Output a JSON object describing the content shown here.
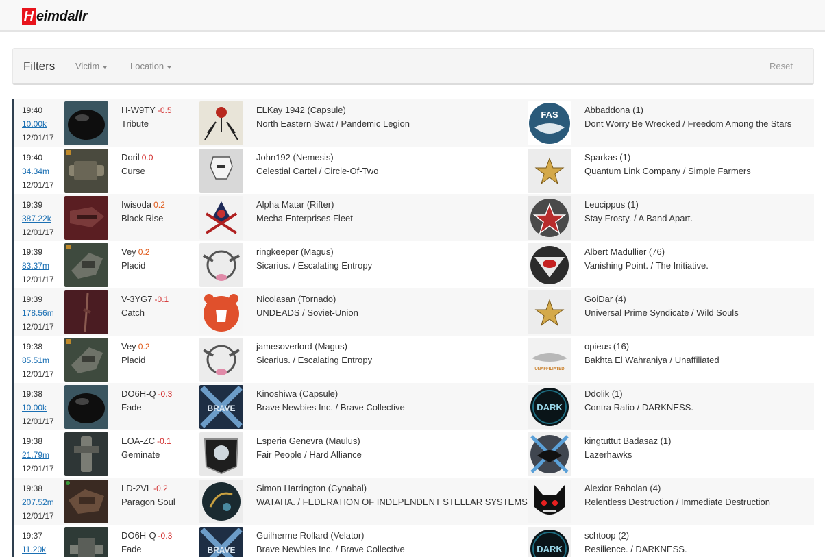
{
  "brand": {
    "first_letter": "H",
    "rest": "eimdallr"
  },
  "filters": {
    "title": "Filters",
    "victim_label": "Victim",
    "location_label": "Location",
    "reset_label": "Reset"
  },
  "kills": [
    {
      "time": "19:40",
      "value": "10.00k",
      "date": "12/01/17",
      "system": "H-W9TY",
      "security": "-0.5",
      "ship": "Tribute",
      "victim": "ELKay 1942 (Capsule)",
      "victim_org": "North Eastern Swat / Pandemic Legion",
      "killer": "Abbaddona (1)",
      "killer_org": "Dont Worry Be Wrecked / Freedom Among the Stars"
    },
    {
      "time": "19:40",
      "value": "34.34m",
      "date": "12/01/17",
      "system": "Doril",
      "security": "0.0",
      "ship": "Curse",
      "victim": "John192 (Nemesis)",
      "victim_org": "Celestial Cartel / Circle-Of-Two",
      "killer": "Sparkas (1)",
      "killer_org": "Quantum Link Company / Simple Farmers"
    },
    {
      "time": "19:39",
      "value": "387.22k",
      "date": "12/01/17",
      "system": "Iwisoda",
      "security": "0.2",
      "ship": "Black Rise",
      "victim": "Alpha Matar (Rifter)",
      "victim_org": "Mecha Enterprises Fleet",
      "killer": "Leucippus (1)",
      "killer_org": "Stay Frosty. / A Band Apart."
    },
    {
      "time": "19:39",
      "value": "83.37m",
      "date": "12/01/17",
      "system": "Vey",
      "security": "0.2",
      "ship": "Placid",
      "victim": "ringkeeper (Magus)",
      "victim_org": "Sicarius. / Escalating Entropy",
      "killer": "Albert Madullier (76)",
      "killer_org": "Vanishing Point. / The Initiative."
    },
    {
      "time": "19:39",
      "value": "178.56m",
      "date": "12/01/17",
      "system": "V-3YG7",
      "security": "-0.1",
      "ship": "Catch",
      "victim": "Nicolasan (Tornado)",
      "victim_org": "UNDEADS / Soviet-Union",
      "killer": "GoiDar (4)",
      "killer_org": "Universal Prime Syndicate / Wild Souls"
    },
    {
      "time": "19:38",
      "value": "85.51m",
      "date": "12/01/17",
      "system": "Vey",
      "security": "0.2",
      "ship": "Placid",
      "victim": "jamesoverlord (Magus)",
      "victim_org": "Sicarius. / Escalating Entropy",
      "killer": "opieus (16)",
      "killer_org": "Bakhta El Wahraniya / Unaffiliated"
    },
    {
      "time": "19:38",
      "value": "10.00k",
      "date": "12/01/17",
      "system": "DO6H-Q",
      "security": "-0.3",
      "ship": "Fade",
      "victim": "Kinoshiwa (Capsule)",
      "victim_org": "Brave Newbies Inc. / Brave Collective",
      "killer": "Ddolik (1)",
      "killer_org": "Contra Ratio / DARKNESS."
    },
    {
      "time": "19:38",
      "value": "21.79m",
      "date": "12/01/17",
      "system": "EOA-ZC",
      "security": "-0.1",
      "ship": "Geminate",
      "victim": "Esperia Genevra (Maulus)",
      "victim_org": "Fair People / Hard Alliance",
      "killer": "kingtuttut Badasaz (1)",
      "killer_org": "Lazerhawks"
    },
    {
      "time": "19:38",
      "value": "207.52m",
      "date": "12/01/17",
      "system": "LD-2VL",
      "security": "-0.2",
      "ship": "Paragon Soul",
      "victim": "Simon Harrington (Cynabal)",
      "victim_org": "WATAHA. / FEDERATION OF INDEPENDENT STELLAR SYSTEMS",
      "killer": "Alexior Raholan (4)",
      "killer_org": "Relentless Destruction / Immediate Destruction"
    },
    {
      "time": "19:37",
      "value": "11.20k",
      "date": "",
      "system": "DO6H-Q",
      "security": "-0.3",
      "ship": "Fade",
      "victim": "Guilherme Rollard (Velator)",
      "victim_org": "Brave Newbies Inc. / Brave Collective",
      "killer": "schtoop (2)",
      "killer_org": "Resilience. / DARKNESS."
    }
  ],
  "logo_text": {
    "fas": "FAS",
    "brave": "BRAVE",
    "dark": "DARK",
    "unaffiliated": "UNAFFILIATED"
  }
}
